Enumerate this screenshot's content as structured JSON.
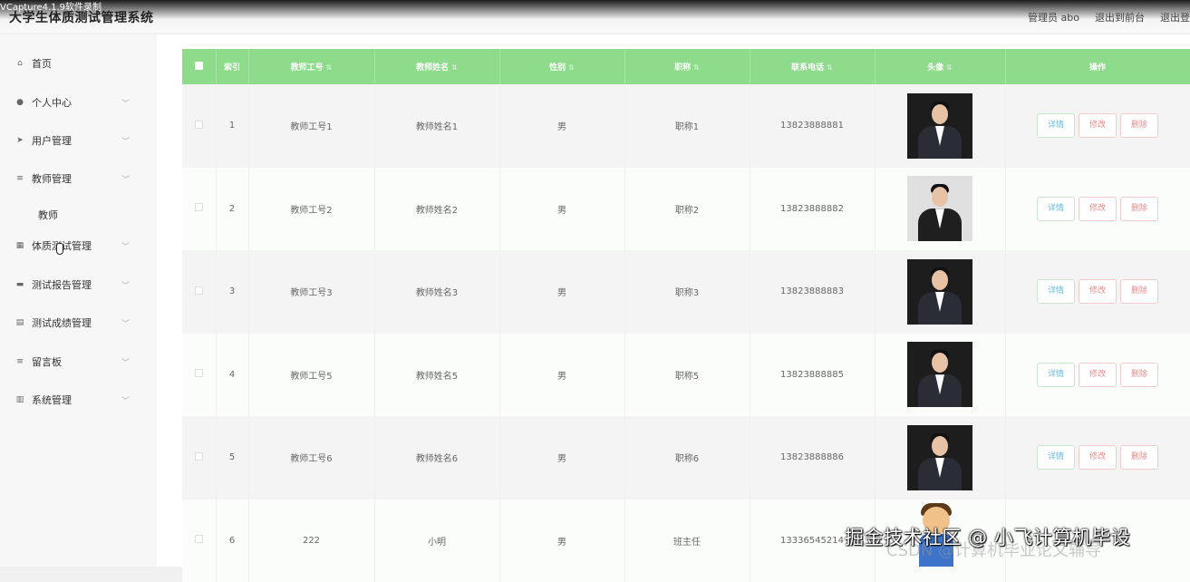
{
  "recorder_label": "VCapture4.1.9软件录制",
  "app_title": "大学生体质测试管理系统",
  "top_links": [
    "管理员 abo",
    "退出到前台",
    "退出登"
  ],
  "sidebar": {
    "items": [
      {
        "icon": "home-icon",
        "label": "首页",
        "chevron": false
      },
      {
        "icon": "user-icon",
        "label": "个人中心",
        "chevron": true
      },
      {
        "icon": "send-icon",
        "label": "用户管理",
        "chevron": true
      },
      {
        "icon": "list-icon",
        "label": "教师管理",
        "chevron": true
      },
      {
        "icon": "grid-icon",
        "label": "体质测试管理",
        "chevron": true
      },
      {
        "icon": "report-icon",
        "label": "测试报告管理",
        "chevron": true
      },
      {
        "icon": "score-icon",
        "label": "测试成绩管理",
        "chevron": true
      },
      {
        "icon": "message-icon",
        "label": "留言板",
        "chevron": true
      },
      {
        "icon": "settings-icon",
        "label": "系统管理",
        "chevron": true
      }
    ],
    "sub_item": "教师"
  },
  "table": {
    "headers": [
      "索引",
      "教师工号",
      "教师姓名",
      "性别",
      "职称",
      "联系电话",
      "头像",
      "操作"
    ],
    "rows": [
      {
        "index": "1",
        "job_no": "教师工号1",
        "name": "教师姓名1",
        "gender": "男",
        "title": "职称1",
        "phone": "13823888881",
        "avatar": "photo-male"
      },
      {
        "index": "2",
        "job_no": "教师工号2",
        "name": "教师姓名2",
        "gender": "男",
        "title": "职称2",
        "phone": "13823888882",
        "avatar": "photo-female"
      },
      {
        "index": "3",
        "job_no": "教师工号3",
        "name": "教师姓名3",
        "gender": "男",
        "title": "职称3",
        "phone": "13823888883",
        "avatar": "photo-male"
      },
      {
        "index": "4",
        "job_no": "教师工号5",
        "name": "教师姓名5",
        "gender": "男",
        "title": "职称5",
        "phone": "13823888885",
        "avatar": "photo-male"
      },
      {
        "index": "5",
        "job_no": "教师工号6",
        "name": "教师姓名6",
        "gender": "男",
        "title": "职称6",
        "phone": "13823888886",
        "avatar": "photo-male"
      },
      {
        "index": "6",
        "job_no": "222",
        "name": "小明",
        "gender": "男",
        "title": "班主任",
        "phone": "13336545214",
        "avatar": "cartoon"
      }
    ],
    "actions": {
      "view": "详情",
      "edit": "修改",
      "delete": "删除"
    }
  },
  "watermark": "掘金技术社区 @ 小飞计算机毕设",
  "watermark2": "CSDN @计算机毕业论文辅导",
  "colors": {
    "header_green": "#8edb8c",
    "view_blue": "#6cb8d8",
    "danger_red": "#e88a8a"
  }
}
